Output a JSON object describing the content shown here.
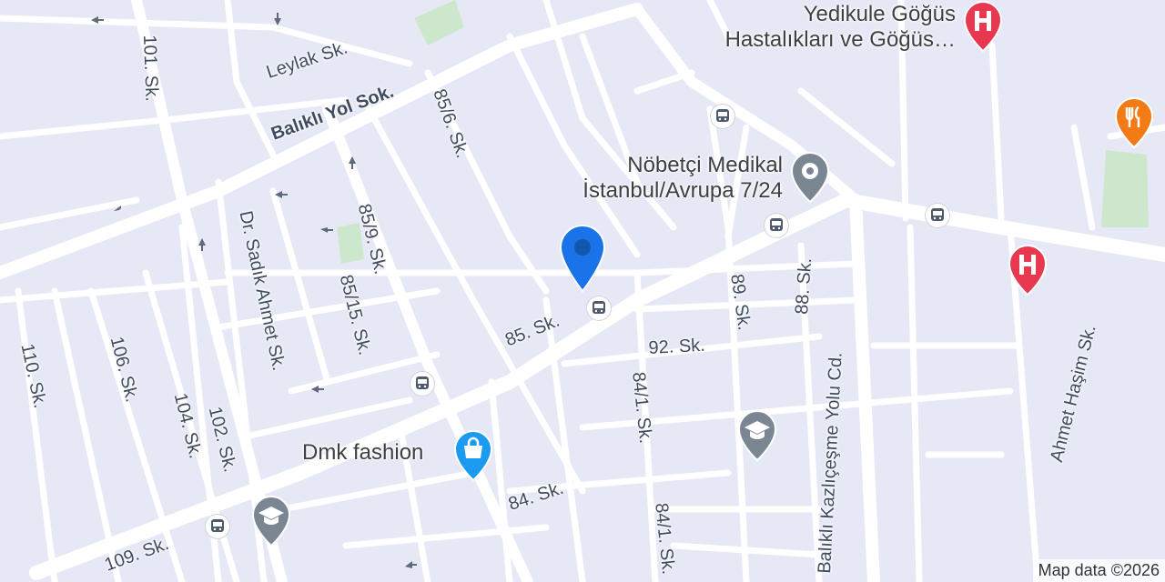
{
  "map": {
    "attribution": "Map data ©2026"
  },
  "streets": {
    "leylak": "Leylak Sk.",
    "balikli_yol": "Balıklı Yol Sok.",
    "s101": "101. Sk.",
    "s85_6": "85/6. Sk.",
    "s85_9": "85/9. Sk.",
    "s85_15": "85/15. Sk.",
    "dr_sadik": "Dr. Sadık Ahmet Sk.",
    "s85": "85. Sk.",
    "s92": "92. Sk.",
    "s89": "89. Sk.",
    "s88": "88. Sk.",
    "s84_1a": "84/1. Sk.",
    "s84_1b": "84/1. Sk.",
    "s84": "84. Sk.",
    "s110": "110. Sk.",
    "s106": "106. Sk.",
    "s104": "104. Sk.",
    "s102": "102. Sk.",
    "s109": "109. Sk.",
    "balikli_kazlicesme": "Balıklı Kazlıçeşme Yolu Cd.",
    "ahmet_hasim": "Ahmet Haşim Sk."
  },
  "pois": {
    "hospital_1_line1": "Yedikule Göğüs",
    "hospital_1_line2": "Hastalıkları ve Göğüs…",
    "pharmacy_line1": "Nöbetçi Medikal",
    "pharmacy_line2": "İstanbul/Avrupa 7/24",
    "shop": "Dmk fashion"
  },
  "icons": {
    "hospital": "hospital-icon",
    "restaurant": "restaurant-icon",
    "medical": "medical-icon",
    "shopping": "shopping-bag-icon",
    "school": "school-icon",
    "bus": "bus-stop-icon",
    "location": "location-pin-icon"
  },
  "colors": {
    "background": "#e6e9f5",
    "road": "#ffffff",
    "park": "#cfe7d0",
    "hospital_red": "#e8384f",
    "restaurant_orange": "#f27b16",
    "pin_blue": "#1a73e8",
    "poi_grey": "#7b8693",
    "shop_blue": "#1a9bf0"
  }
}
